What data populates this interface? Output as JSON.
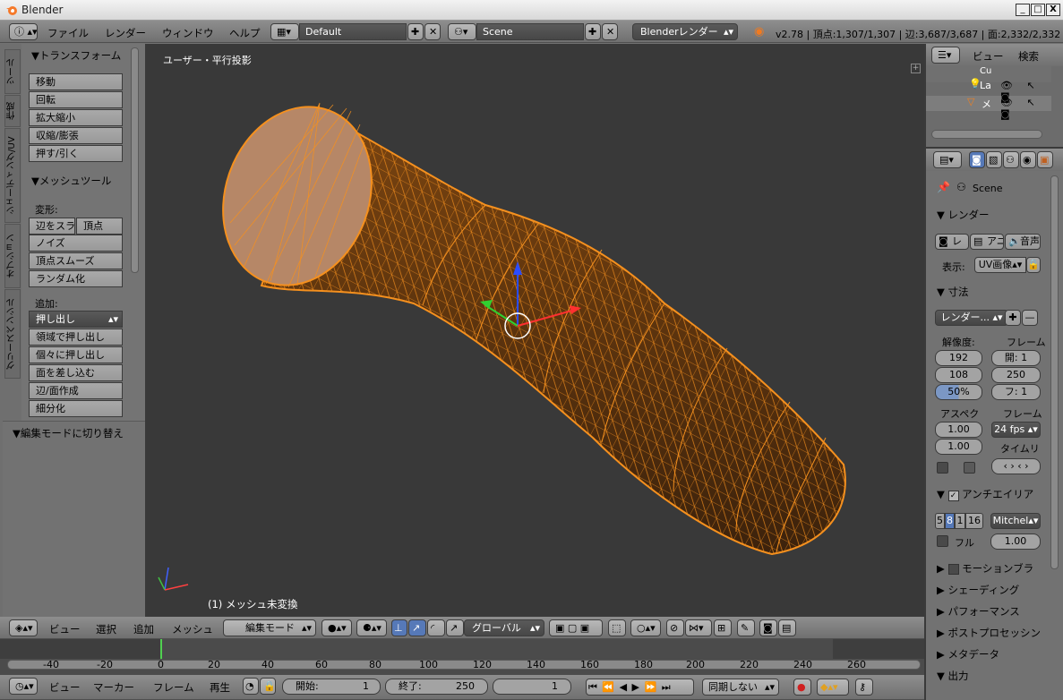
{
  "window": {
    "title": "Blender",
    "min": "_",
    "max": "□",
    "close": "X"
  },
  "top": {
    "menus": [
      "ファイル",
      "レンダー",
      "ウィンドウ",
      "ヘルプ"
    ],
    "layout": "Default",
    "scene": "Scene",
    "engine": "Blenderレンダー",
    "stats": "v2.78 | 頂点:1,307/1,307 | 辺:3,687/3,687 | 面:2,332/2,332 |"
  },
  "tabs": [
    "ツール",
    "作成",
    "シェーディング/UV",
    "オプション",
    "グリースペンシル"
  ],
  "tools": {
    "transform_head": "▼トランスフォーム",
    "transform": [
      "移動",
      "回転",
      "拡大縮小",
      "収縮/膨張",
      "押す/引く"
    ],
    "mesh_head": "▼メッシュツール",
    "deform_label": "変形:",
    "slide_edge": "辺をスライド",
    "slide_vertex": "頂点",
    "deform": [
      "ノイズ",
      "頂点スムーズ",
      "ランダム化"
    ],
    "add_label": "追加:",
    "extrude": "押し出し",
    "add": [
      "領域で押し出し",
      "個々に押し出し",
      "面を差し込む",
      "辺/面作成",
      "細分化"
    ],
    "edit_mode_head": "▼編集モードに切り替え"
  },
  "viewport": {
    "view_name": "ユーザー・平行投影",
    "object_info": "(1) メッシュ未変換",
    "colors": {
      "background": "#393939",
      "wire": "#f5901e",
      "face": "#f0a050"
    }
  },
  "viewport_header": {
    "menus": [
      "ビュー",
      "選択",
      "追加",
      "メッシュ"
    ],
    "mode": "編集モード",
    "orientation": "グローバル"
  },
  "timeline": {
    "ticks": [
      "-40",
      "-20",
      "0",
      "20",
      "40",
      "60",
      "80",
      "100",
      "120",
      "140",
      "160",
      "180",
      "200",
      "220",
      "240",
      "260"
    ],
    "menus": [
      "ビュー",
      "マーカー",
      "フレーム",
      "再生"
    ],
    "start_label": "開始:",
    "start": "1",
    "end_label": "終了:",
    "end": "250",
    "current": "1",
    "sync": "同期しない"
  },
  "outliner": {
    "menus": [
      "ビュー",
      "検索"
    ],
    "rows": [
      "Cu",
      "La",
      "メ"
    ]
  },
  "properties": {
    "scene": "Scene",
    "render_head": "▼ レンダー",
    "render_btn": "レ",
    "anim_btn": "アニ",
    "audio_btn": "音声",
    "display_label": "表示:",
    "display_value": "UV画像",
    "dimensions_head": "▼ 寸法",
    "preset": "レンダー...",
    "res_label": "解像度:",
    "frame_label": "フレーム",
    "res_x": "192",
    "res_y": "108",
    "res_pct": "50%",
    "frame_start": "開: 1",
    "frame_end": "250",
    "frame_step": "フ: 1",
    "aspect_label": "アスペク",
    "frame_rate_label": "フレーム",
    "aspect_x": "1.00",
    "aspect_y": "1.00",
    "fps": "24 fps",
    "time_remap": "タイムリ",
    "aa_head": "アンチエイリア",
    "aa_samples": [
      "5",
      "8",
      "1",
      "16"
    ],
    "aa_filter": "Mitchel",
    "full_label": "フル",
    "full_value": "1.00",
    "collapsed": [
      "モーションブラ",
      "シェーディング",
      "パフォーマンス",
      "ポストプロセッシン",
      "メタデータ"
    ],
    "output_head": "▼ 出力"
  }
}
